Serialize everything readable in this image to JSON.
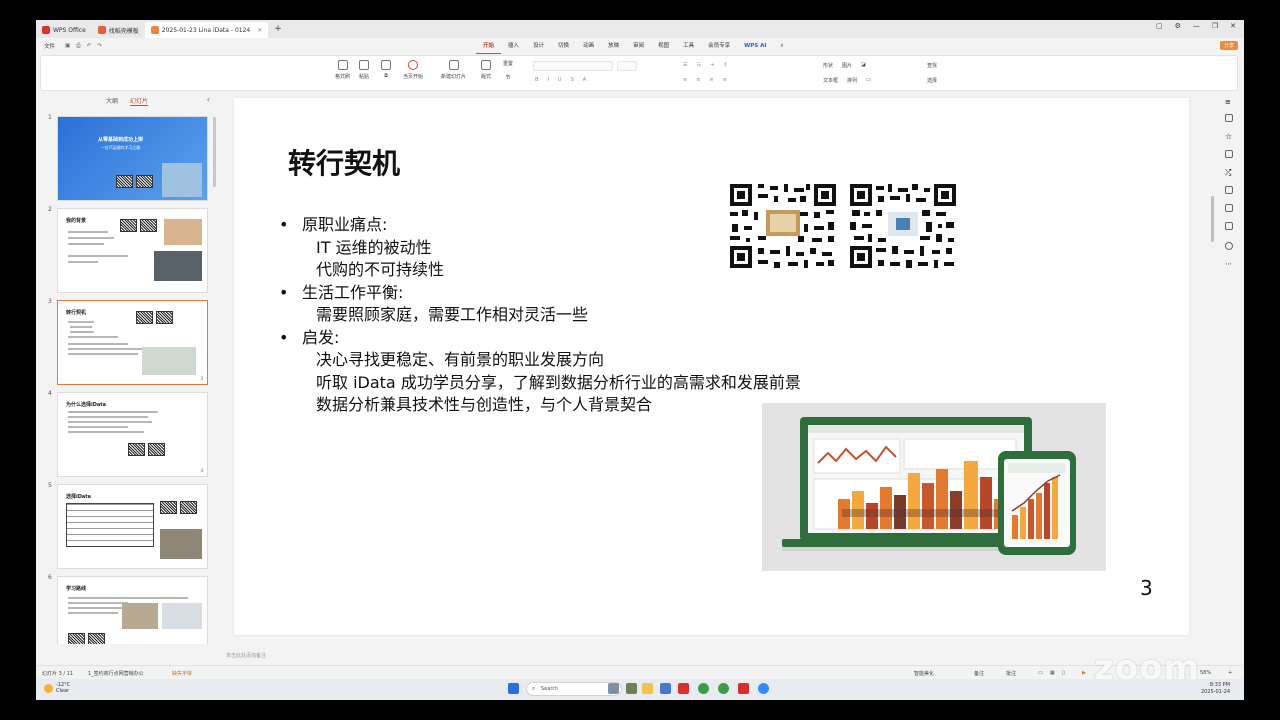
{
  "tabs": [
    {
      "label": "WPS Office",
      "active": false
    },
    {
      "label": "找稻壳模板",
      "active": false
    },
    {
      "label": "2025-01-23 Lina iData - 0124",
      "active": true
    }
  ],
  "menubar": {
    "file": "文件",
    "menus": [
      "开始",
      "插入",
      "设计",
      "切换",
      "动画",
      "放映",
      "审阅",
      "视图",
      "工具",
      "会员专享"
    ],
    "ai_label": "WPS AI",
    "share_label": "分享"
  },
  "ribbon": {
    "format_painter": "格式刷",
    "paste": "粘贴",
    "from_start": "当页开始",
    "new_slide": "新建幻灯片",
    "layout": "版式",
    "section": "节",
    "reset": "重置",
    "shape": "形状",
    "picture": "图片",
    "textbox": "文本框",
    "arrange": "排列",
    "find": "查找",
    "select": "选择"
  },
  "left_panel": {
    "tab_outline": "大纲",
    "tab_slides": "幻灯片",
    "thumbs": [
      {
        "num": "1",
        "title": "从零基础到成功上岸",
        "subtitle": "一位IT运维的学习之路",
        "selected": false
      },
      {
        "num": "2",
        "title": "我的背景",
        "selected": false
      },
      {
        "num": "3",
        "title": "转行契机",
        "selected": true
      },
      {
        "num": "4",
        "title": "为什么选择iData",
        "selected": false
      },
      {
        "num": "5",
        "title": "选择iData",
        "selected": false
      },
      {
        "num": "6",
        "title": "学习路线",
        "selected": false
      }
    ]
  },
  "slide": {
    "title": "转行契机",
    "bullets": [
      {
        "text": "原职业痛点:",
        "subs": [
          "IT 运维的被动性",
          "代购的不可持续性"
        ]
      },
      {
        "text": "生活工作平衡:",
        "subs": [
          "需要照顾家庭，需要工作相对灵活一些"
        ]
      },
      {
        "text": "启发:",
        "subs": [
          "决心寻找更稳定、有前景的职业发展方向",
          "听取 iData 成功学员分享，了解到数据分析行业的高需求和发展前景",
          "数据分析兼具技术性与创造性，与个人背景契合"
        ]
      }
    ],
    "bullet_glyph": "•",
    "page_number": "3"
  },
  "notes_placeholder": "单击此处添加备注",
  "statusbar": {
    "slide_count": "幻灯片 3 / 11",
    "theme": "1_签约商行点网营销办公",
    "missing_font": "缺失字体",
    "smart_beautify": "智能美化",
    "notes": "备注",
    "comments": "批注",
    "zoom": "58%"
  },
  "zoom_watermark": "zoom",
  "taskbar": {
    "temp": "-12°C",
    "weather": "Clear",
    "search_placeholder": "Search",
    "time": "8:33 PM",
    "date": "2025-01-24"
  }
}
